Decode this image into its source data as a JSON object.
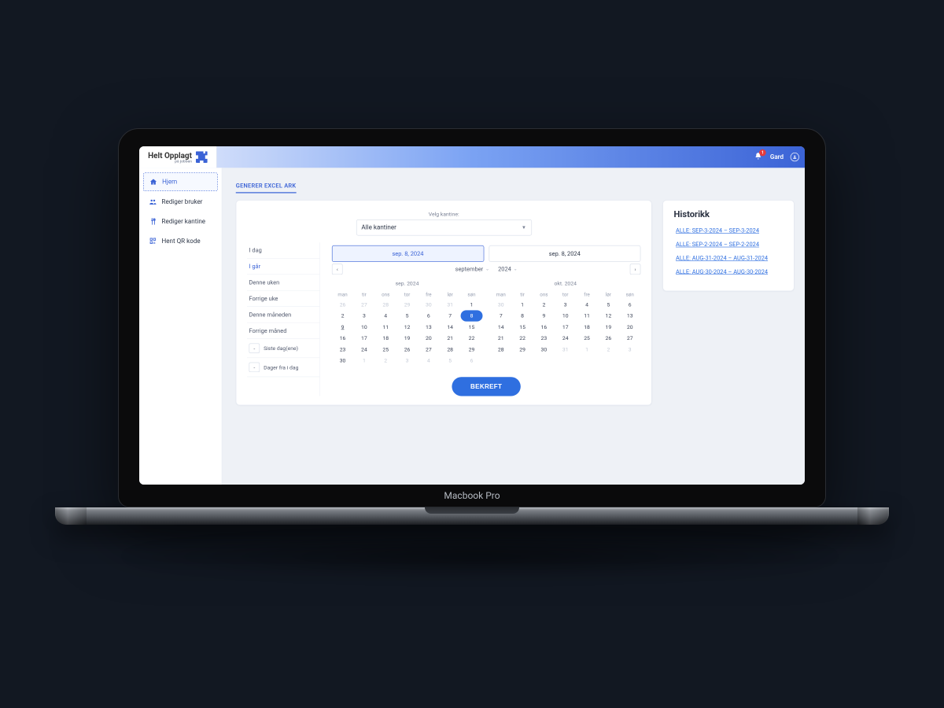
{
  "device_label": "Macbook Pro",
  "brand": {
    "name": "Helt Opplagt",
    "tagline": "på jobben"
  },
  "header": {
    "notif_count": "1",
    "user_name": "Gard"
  },
  "sidebar": {
    "items": [
      {
        "label": "Hjem"
      },
      {
        "label": "Rediger bruker"
      },
      {
        "label": "Rediger kantine"
      },
      {
        "label": "Hent QR kode"
      }
    ]
  },
  "tabs": {
    "active": "GENERER EXCEL ARK"
  },
  "canteen": {
    "label": "Velg kantine:",
    "selected": "Alle kantiner"
  },
  "date_range": {
    "start": "sep. 8, 2024",
    "end": "sep. 8, 2024"
  },
  "presets": {
    "today": "I dag",
    "yesterday": "I går",
    "this_week": "Denne uken",
    "last_week": "Forrige uke",
    "this_month": "Denne måneden",
    "last_month": "Forrige måned",
    "last_n_days": "Siste dag(ene)",
    "days_from_today": "Dager fra i dag",
    "empty_n": "-"
  },
  "calendar": {
    "month_label": "september",
    "year_label": "2024",
    "dow": [
      "man",
      "tir",
      "ons",
      "tor",
      "fre",
      "lør",
      "søn"
    ],
    "left": {
      "title": "sep. 2024",
      "weeks": [
        {
          "mute": [
            0,
            1,
            2,
            3,
            4,
            5
          ],
          "days": [
            "26",
            "27",
            "28",
            "29",
            "30",
            "31",
            "1"
          ]
        },
        {
          "mute": [],
          "days": [
            "2",
            "3",
            "4",
            "5",
            "6",
            "7",
            "8"
          ],
          "sel": 6
        },
        {
          "mute": [],
          "days": [
            "9",
            "10",
            "11",
            "12",
            "13",
            "14",
            "15"
          ],
          "today": 0
        },
        {
          "mute": [],
          "days": [
            "16",
            "17",
            "18",
            "19",
            "20",
            "21",
            "22"
          ]
        },
        {
          "mute": [],
          "days": [
            "23",
            "24",
            "25",
            "26",
            "27",
            "28",
            "29"
          ]
        },
        {
          "mute": [
            1,
            2,
            3,
            4,
            5,
            6
          ],
          "days": [
            "30",
            "1",
            "2",
            "3",
            "4",
            "5",
            "6"
          ]
        }
      ]
    },
    "right": {
      "title": "okt. 2024",
      "weeks": [
        {
          "mute": [
            0
          ],
          "days": [
            "30",
            "1",
            "2",
            "3",
            "4",
            "5",
            "6"
          ]
        },
        {
          "mute": [],
          "days": [
            "7",
            "8",
            "9",
            "10",
            "11",
            "12",
            "13"
          ]
        },
        {
          "mute": [],
          "days": [
            "14",
            "15",
            "16",
            "17",
            "18",
            "19",
            "20"
          ]
        },
        {
          "mute": [],
          "days": [
            "21",
            "22",
            "23",
            "24",
            "25",
            "26",
            "27"
          ]
        },
        {
          "mute": [
            3,
            4,
            5,
            6
          ],
          "days": [
            "28",
            "29",
            "30",
            "31",
            "1",
            "2",
            "3"
          ]
        }
      ]
    }
  },
  "confirm_label": "BEKREFT",
  "history": {
    "title": "Historikk",
    "items": [
      "ALLE: SEP-3-2024 – SEP-3-2024",
      "ALLE: SEP-2-2024 – SEP-2-2024",
      "ALLE: AUG-31-2024 – AUG-31-2024",
      "ALLE: AUG-30-2024 – AUG-30-2024"
    ]
  }
}
